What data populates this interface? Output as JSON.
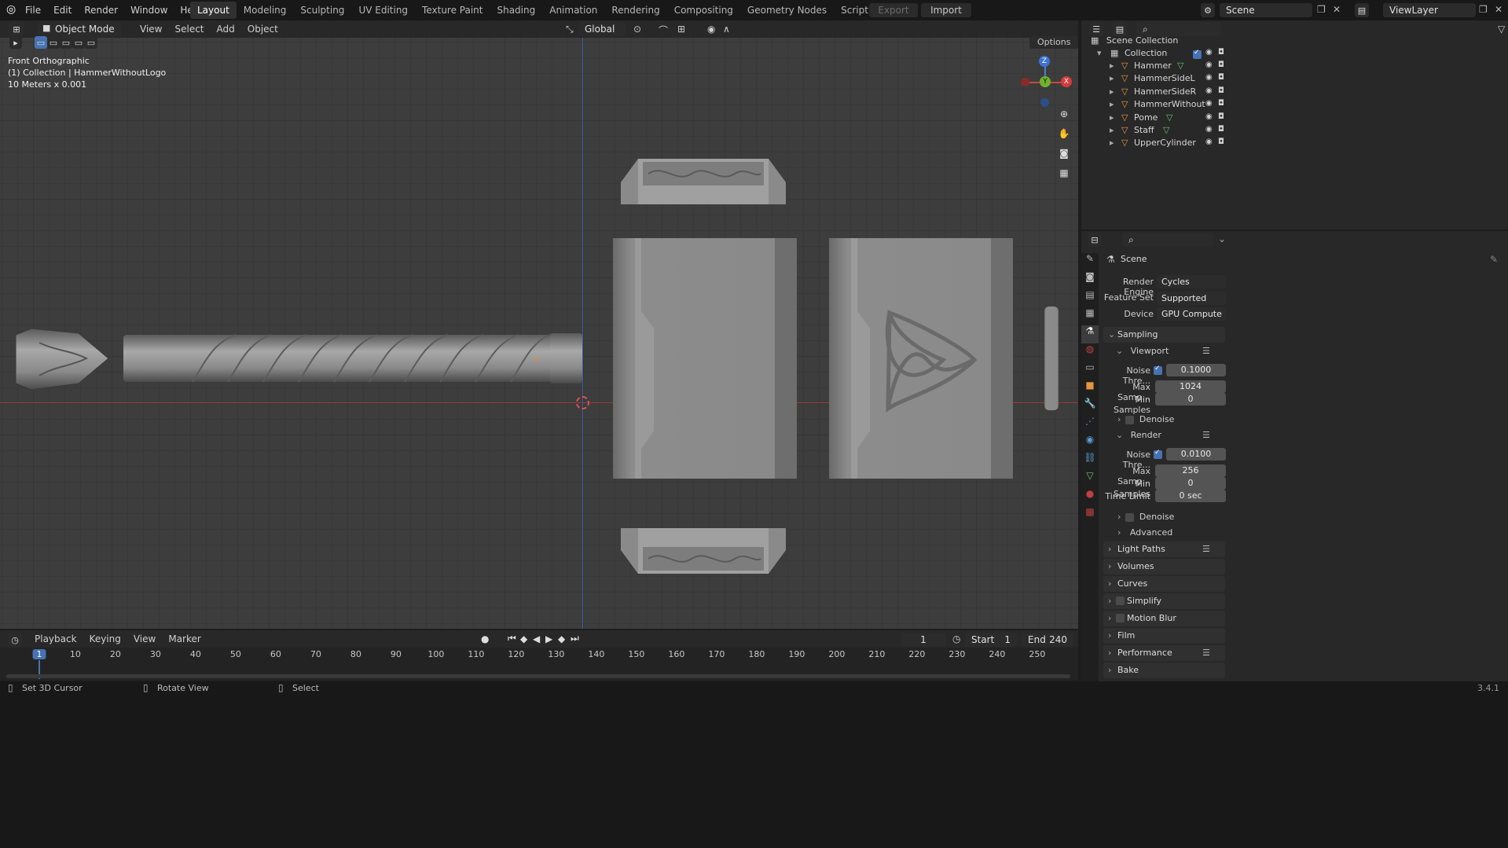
{
  "topbar": {
    "menus": [
      "File",
      "Edit",
      "Render",
      "Window",
      "Help"
    ],
    "workspaces": [
      "Layout",
      "Modeling",
      "Sculpting",
      "UV Editing",
      "Texture Paint",
      "Shading",
      "Animation",
      "Rendering",
      "Compositing",
      "Geometry Nodes",
      "Scripting"
    ],
    "active_workspace": "Layout",
    "export_label": "Export",
    "import_label": "Import",
    "scene_name": "Scene",
    "view_layer": "ViewLayer"
  },
  "viewport": {
    "mode": "Object Mode",
    "menus": [
      "View",
      "Select",
      "Add",
      "Object"
    ],
    "orientation": "Global",
    "options_label": "Options",
    "overlay_line1": "Front Orthographic",
    "overlay_line2": "(1) Collection | HammerWithoutLogo",
    "overlay_line3": "10 Meters x 0.001",
    "gizmo": {
      "z": "Z",
      "y": "Y",
      "x": "X"
    }
  },
  "outliner": {
    "scene_collection": "Scene Collection",
    "collection": "Collection",
    "objects": [
      "Hammer",
      "HammerSideL",
      "HammerSideR",
      "HammerWithout",
      "Pome",
      "Staff",
      "UpperCylinder"
    ]
  },
  "properties": {
    "context": "Scene",
    "render_engine_label": "Render Engine",
    "render_engine": "Cycles",
    "feature_set_label": "Feature Set",
    "feature_set": "Supported",
    "device_label": "Device",
    "device": "GPU Compute",
    "sampling": "Sampling",
    "viewport": "Viewport",
    "noise_thresh_label": "Noise Thre...",
    "viewport_noise": "0.1000",
    "max_samples_label": "Max Samp...",
    "viewport_max_samples": "1024",
    "min_samples_label": "Min Samples",
    "viewport_min_samples": "0",
    "denoise": "Denoise",
    "render": "Render",
    "render_noise": "0.0100",
    "render_max_samples": "256",
    "render_min_samples": "0",
    "time_limit_label": "Time Limit",
    "time_limit": "0 sec",
    "advanced": "Advanced",
    "panels": [
      "Light Paths",
      "Volumes",
      "Curves",
      "Simplify",
      "Motion Blur",
      "Film",
      "Performance",
      "Bake"
    ]
  },
  "timeline": {
    "menus": [
      "Playback",
      "Keying",
      "View",
      "Marker"
    ],
    "current_frame": "1",
    "start_label": "Start",
    "start": "1",
    "end_label": "End",
    "end": "240",
    "ticks": [
      "1",
      "10",
      "20",
      "30",
      "40",
      "50",
      "60",
      "70",
      "80",
      "90",
      "100",
      "110",
      "120",
      "130",
      "140",
      "150",
      "160",
      "170",
      "180",
      "190",
      "200",
      "210",
      "220",
      "230",
      "240",
      "250"
    ]
  },
  "statusbar": {
    "hint1": "Set 3D Cursor",
    "hint2": "Rotate View",
    "hint3": "Select",
    "version": "3.4.1"
  }
}
